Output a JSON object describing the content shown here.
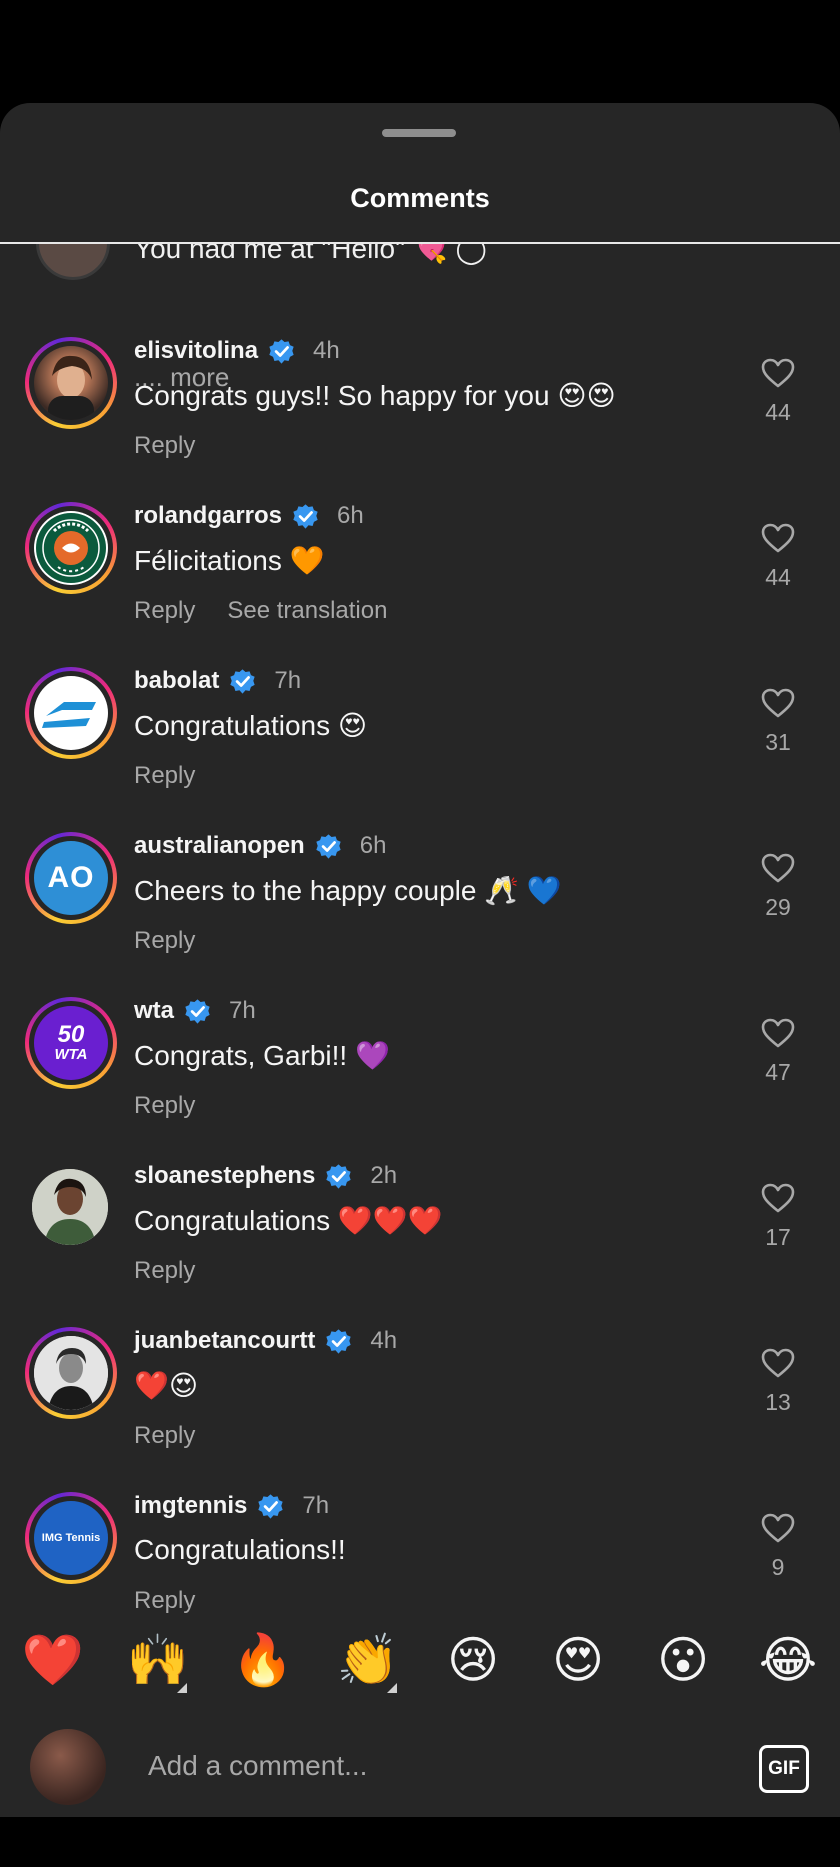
{
  "header": {
    "title": "Comments"
  },
  "previous_comment": {
    "text_partial": "You had me at \"Hello\" 💘 ◯",
    "more_label": ".... more"
  },
  "comments": [
    {
      "username": "elisvitolina",
      "time": "4h",
      "text": "Congrats guys!! So happy for you 😍😍",
      "reply": "Reply",
      "likes": "44",
      "avatar": "photo"
    },
    {
      "username": "rolandgarros",
      "time": "6h",
      "text": "Félicitations 🧡",
      "reply": "Reply",
      "see_translation": "See translation",
      "likes": "44",
      "avatar": "logo"
    },
    {
      "username": "babolat",
      "time": "7h",
      "text": "Congratulations 😍",
      "reply": "Reply",
      "likes": "31",
      "avatar": "logo"
    },
    {
      "username": "australianopen",
      "time": "6h",
      "text": "Cheers to the happy couple 🥂 💙",
      "reply": "Reply",
      "likes": "29",
      "avatar": "logo",
      "logo_text": "AO"
    },
    {
      "username": "wta",
      "time": "7h",
      "text": "Congrats, Garbi!! 💜",
      "reply": "Reply",
      "likes": "47",
      "avatar": "logo",
      "logo_text_top": "50",
      "logo_text_bottom": "WTA"
    },
    {
      "username": "sloanestephens",
      "time": "2h",
      "text": "Congratulations ❤️❤️❤️",
      "reply": "Reply",
      "likes": "17",
      "avatar": "photo"
    },
    {
      "username": "juanbetancourtt",
      "time": "4h",
      "text": "❤️😍",
      "reply": "Reply",
      "likes": "13",
      "avatar": "photo"
    },
    {
      "username": "imgtennis",
      "time": "7h",
      "text": "Congratulations!!",
      "reply": "Reply",
      "likes": "9",
      "avatar": "logo",
      "logo_text": "IMG Tennis"
    }
  ],
  "quick_reactions": [
    "❤️",
    "🙌",
    "🔥",
    "👏",
    "😢",
    "😍",
    "😮",
    "😂"
  ],
  "composer": {
    "placeholder": "Add a comment...",
    "gif_label": "GIF"
  },
  "colors": {
    "background": "#262626",
    "verified": "#3897f0",
    "secondary_text": "#a8a8a8"
  }
}
